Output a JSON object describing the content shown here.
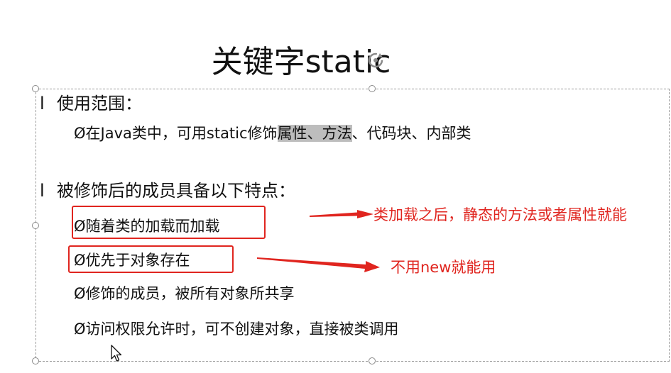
{
  "slide": {
    "title": "关键字static",
    "section1": {
      "bullet_marker": "l",
      "heading": "使用范围：",
      "items": [
        {
          "marker": "Ø",
          "text_before": "在Java类中，可用static修饰",
          "highlighted": "属性、方法",
          "text_after": "、代码块、内部类"
        }
      ]
    },
    "section2": {
      "bullet_marker": "l",
      "heading": "被修饰后的成员具备以下特点：",
      "items": [
        {
          "marker": "Ø",
          "text": "随着类的加载而加载"
        },
        {
          "marker": "Ø",
          "text": "优先于对象存在"
        },
        {
          "marker": "Ø",
          "text": "修饰的成员，被所有对象所共享"
        },
        {
          "marker": "Ø",
          "text": "访问权限允许时，可不创建对象，直接被类调用"
        }
      ]
    }
  },
  "annotations": {
    "note1": "类加载之后，静态的方法或者属性就能",
    "note2": "不用new就能用",
    "color": "#e0251f"
  },
  "colors": {
    "highlight": "#bdbdbd",
    "text": "#111111"
  },
  "icons": [
    "rotate-handle-icon",
    "mouse-cursor-icon"
  ]
}
